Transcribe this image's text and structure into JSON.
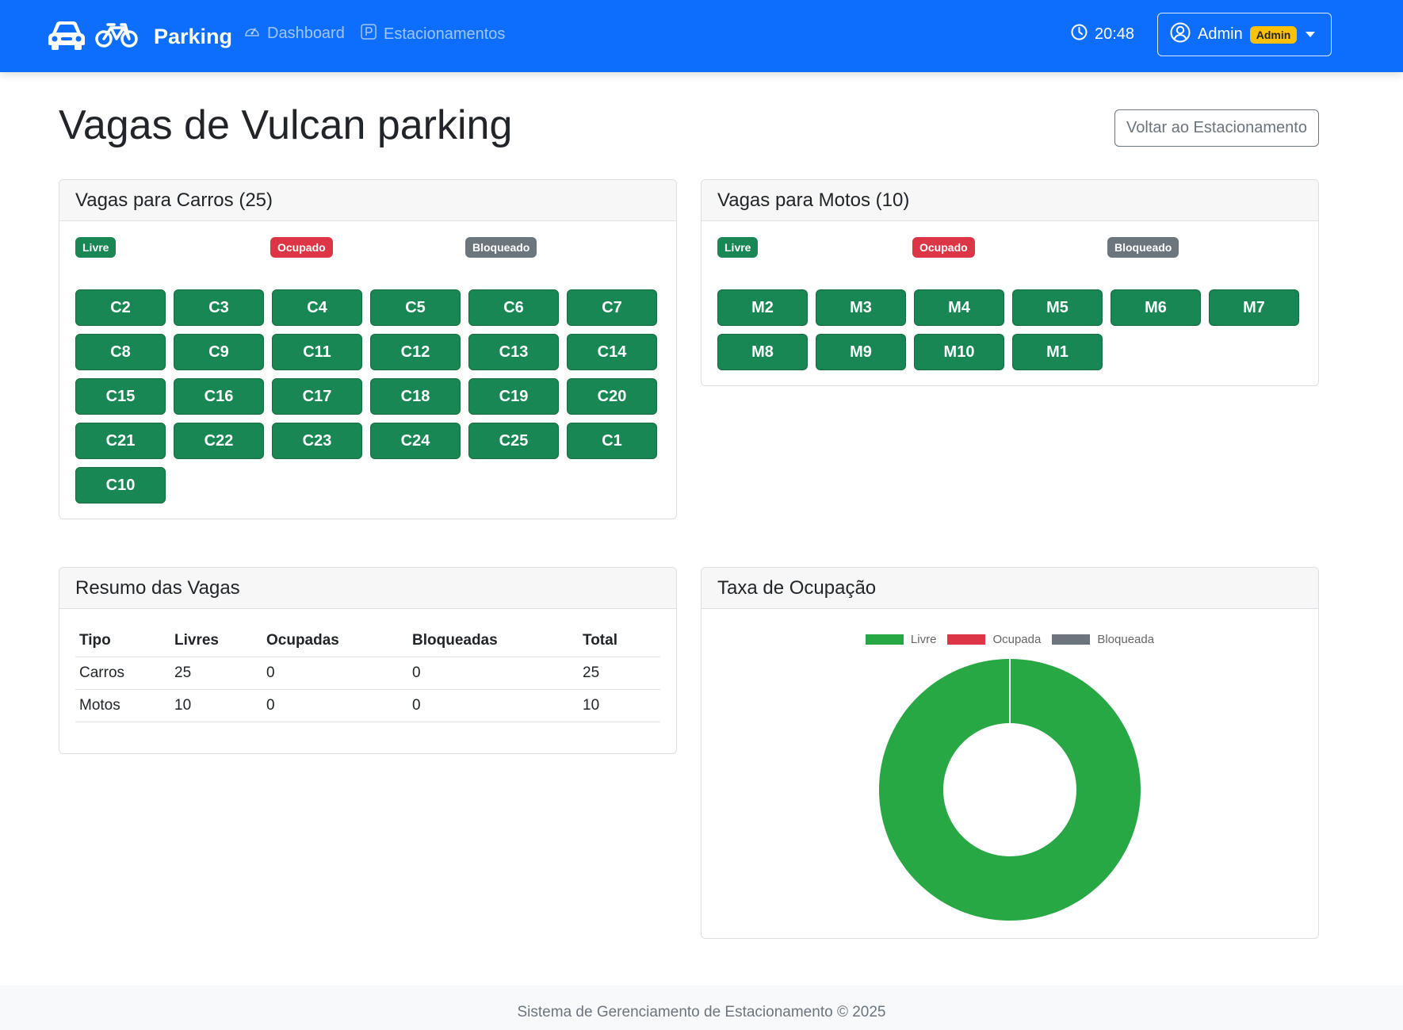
{
  "navbar": {
    "brand": "Parking",
    "links": [
      {
        "label": "Dashboard",
        "icon": "speedometer-icon"
      },
      {
        "label": "Estacionamentos",
        "icon": "parking-p-icon"
      }
    ],
    "time": "20:48",
    "user": {
      "name": "Admin",
      "role_badge": "Admin"
    }
  },
  "page": {
    "title": "Vagas de Vulcan parking",
    "back_button": "Voltar ao Estacionamento"
  },
  "status_legend": {
    "free": "Livre",
    "occupied": "Ocupado",
    "blocked": "Bloqueado"
  },
  "car_spots": {
    "title": "Vagas para Carros (25)",
    "spots": [
      "C2",
      "C3",
      "C4",
      "C5",
      "C6",
      "C7",
      "C8",
      "C9",
      "C11",
      "C12",
      "C13",
      "C14",
      "C15",
      "C16",
      "C17",
      "C18",
      "C19",
      "C20",
      "C21",
      "C22",
      "C23",
      "C24",
      "C25",
      "C1",
      "C10"
    ]
  },
  "moto_spots": {
    "title": "Vagas para Motos (10)",
    "spots": [
      "M2",
      "M3",
      "M4",
      "M5",
      "M6",
      "M7",
      "M8",
      "M9",
      "M10",
      "M1"
    ]
  },
  "summary": {
    "title": "Resumo das Vagas",
    "columns": [
      "Tipo",
      "Livres",
      "Ocupadas",
      "Bloqueadas",
      "Total"
    ],
    "rows": [
      [
        "Carros",
        "25",
        "0",
        "0",
        "25"
      ],
      [
        "Motos",
        "10",
        "0",
        "0",
        "10"
      ]
    ]
  },
  "occupancy": {
    "title": "Taxa de Ocupação"
  },
  "chart_data": {
    "type": "pie",
    "variant": "doughnut",
    "categories": [
      "Livre",
      "Ocupada",
      "Bloqueada"
    ],
    "values": [
      35,
      0,
      0
    ],
    "colors": [
      "#28a745",
      "#dc3545",
      "#6c757d"
    ],
    "legend": "top"
  },
  "colors": {
    "primary": "#0d6efd",
    "spot_free": "#198754",
    "warning": "#ffc107"
  },
  "footer": {
    "text": "Sistema de Gerenciamento de Estacionamento © 2025"
  }
}
